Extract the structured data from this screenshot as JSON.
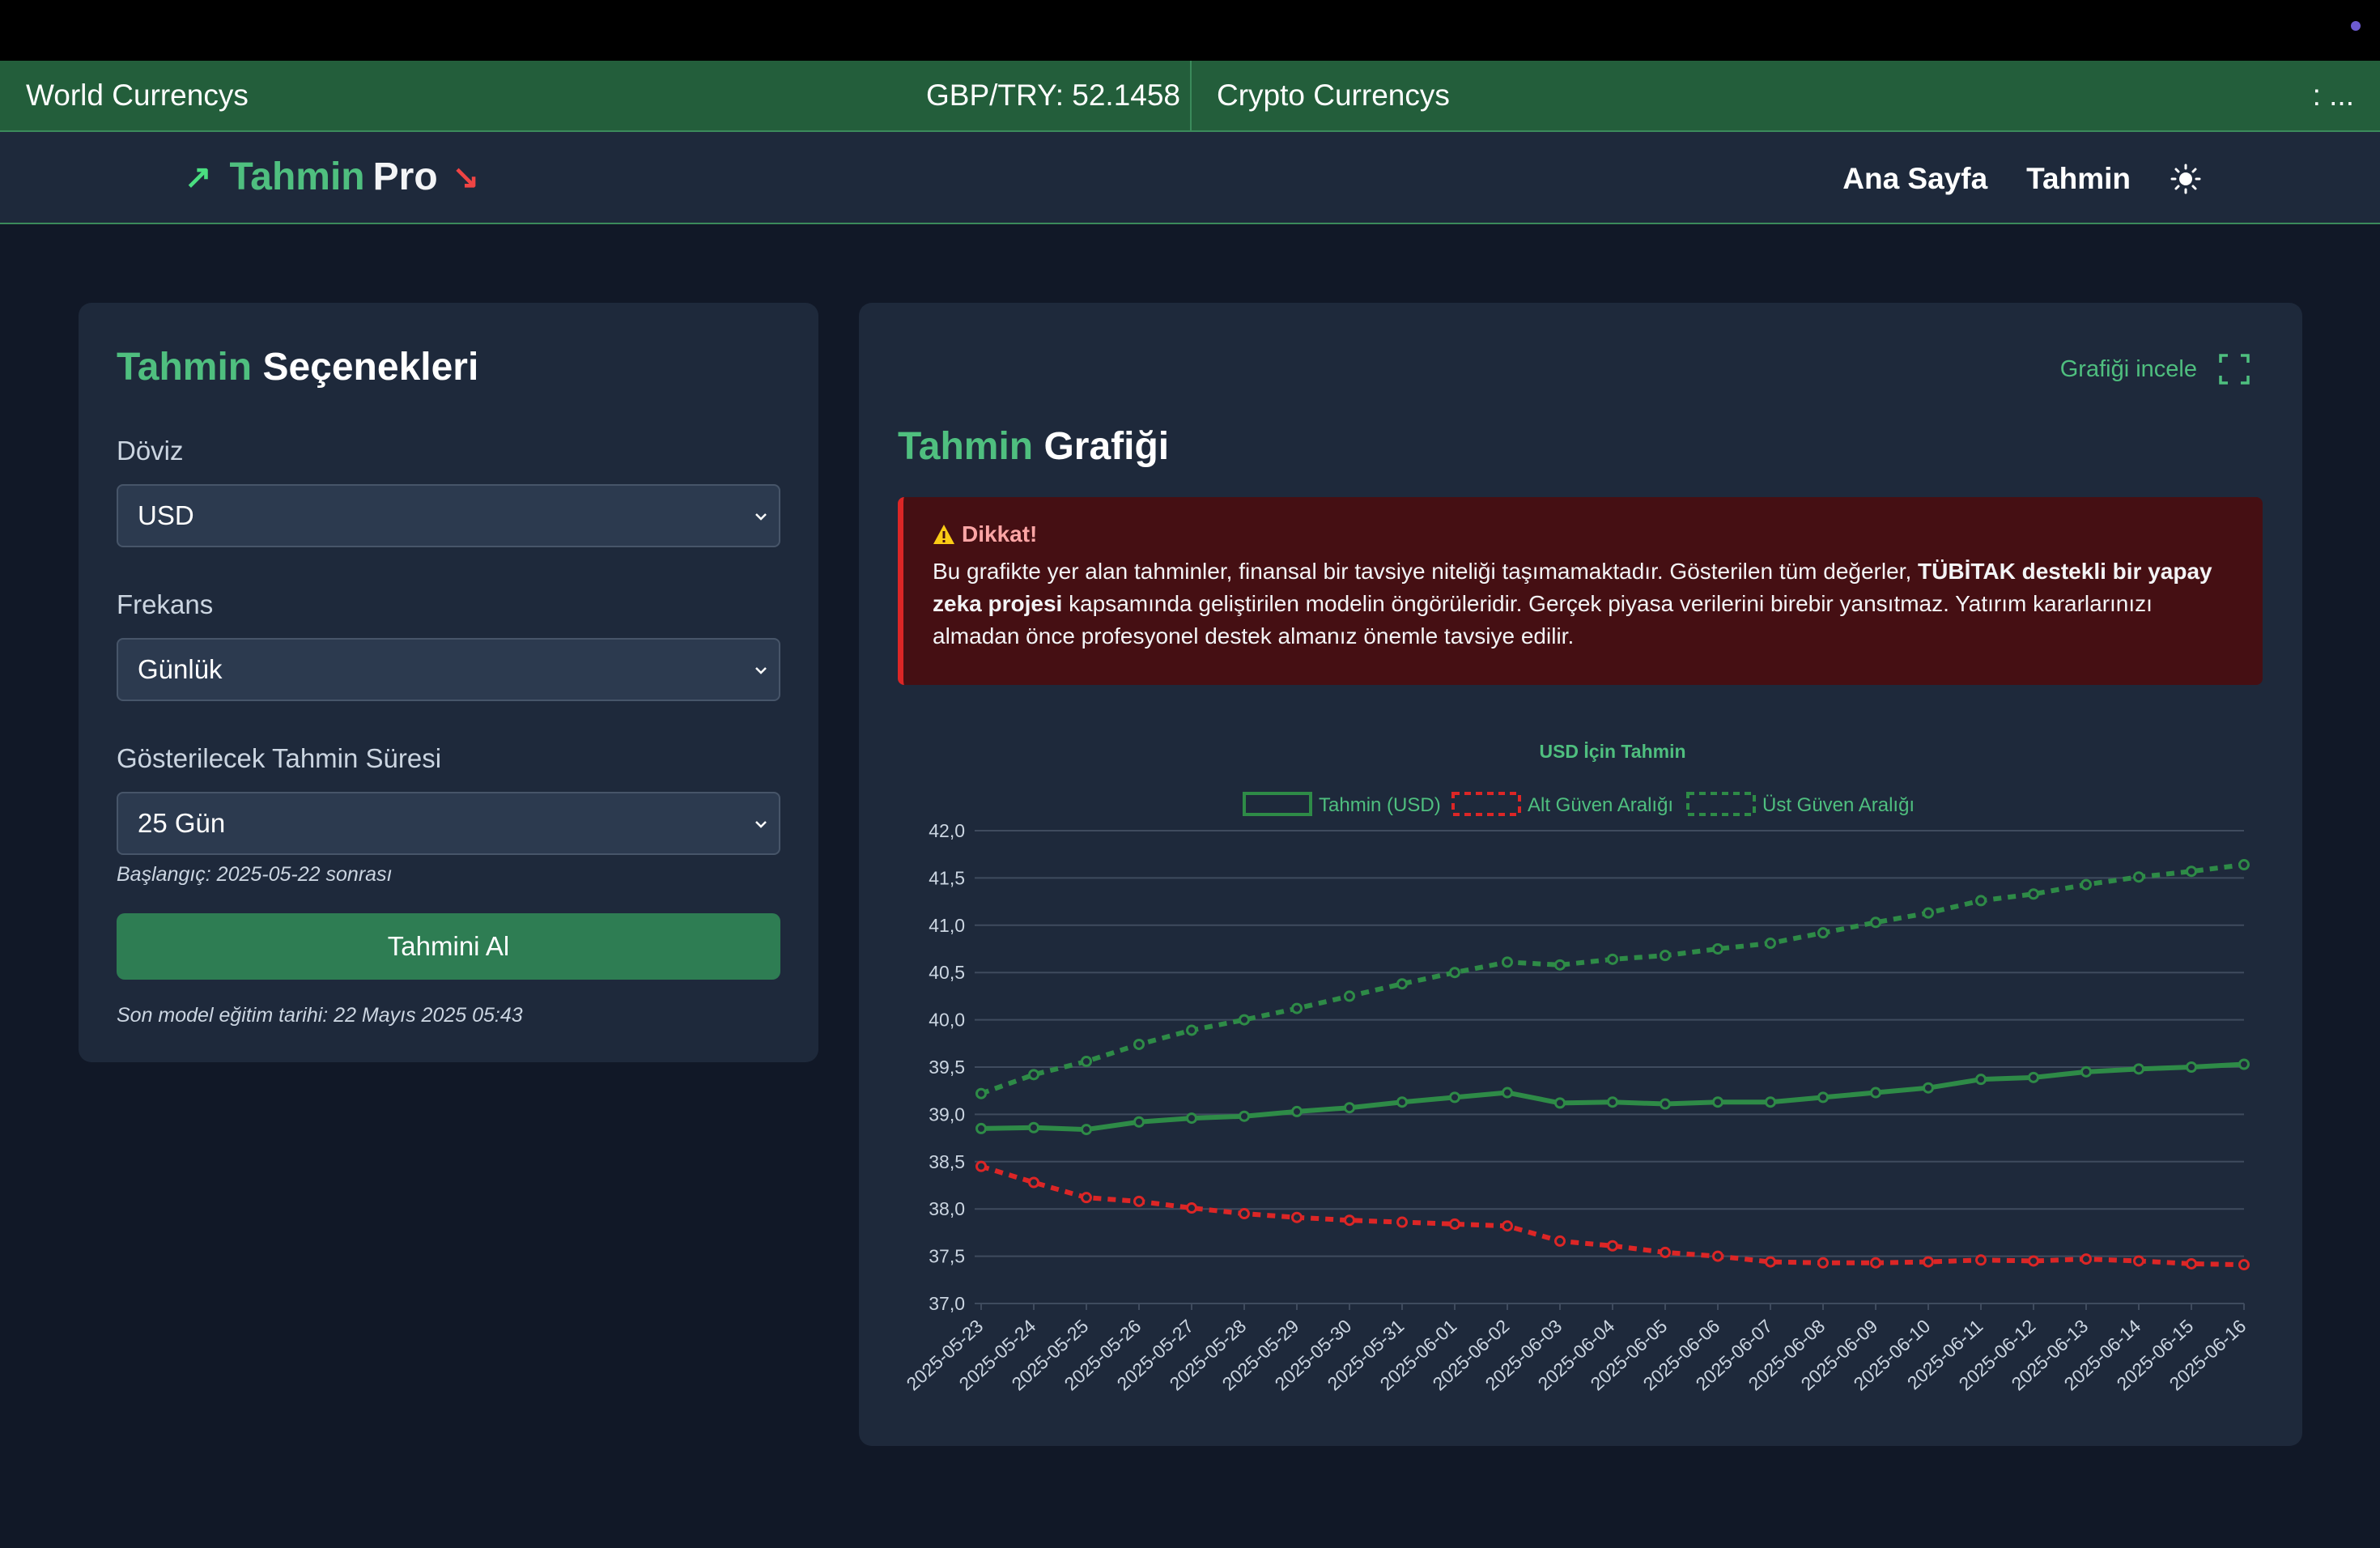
{
  "ticker": {
    "world_label": "World Currencys",
    "rate_text": "GBP/TRY: 52.1458",
    "crypto_label": "Crypto Currencys",
    "more_text": ": ..."
  },
  "navbar": {
    "brand_accent": "Tahmin",
    "brand_rest": "Pro",
    "links": [
      "Ana Sayfa",
      "Tahmin"
    ],
    "theme_icon": "sun-icon"
  },
  "options": {
    "title_accent": "Tahmin",
    "title_rest": "Seçenekleri",
    "currency_label": "Döviz",
    "currency_value": "USD",
    "frequency_label": "Frekans",
    "frequency_value": "Günlük",
    "duration_label": "Gösterilecek Tahmin Süresi",
    "duration_value": "25 Gün",
    "start_note": "Başlangıç: 2025-05-22 sonrası",
    "submit_label": "Tahmini Al",
    "train_note": "Son model eğitim tarihi: 22 Mayıs 2025 05:43"
  },
  "graph_panel": {
    "inspect_label": "Grafiği incele",
    "title_accent": "Tahmin",
    "title_rest": "Grafiği",
    "alert": {
      "title": "Dikkat!",
      "body_1": "Bu grafikte yer alan tahminler, finansal bir tavsiye niteliği taşımamaktadır. Gösterilen tüm değerler,",
      "body_bold": "TÜBİTAK destekli bir yapay zeka projesi",
      "body_2": "kapsamında geliştirilen modelin öngörüleridir. Gerçek piyasa verilerini birebir yansıtmaz. Yatırım kararlarınızı almadan önce profesyonel destek almanız önemle tavsiye edilir."
    }
  },
  "colors": {
    "accent": "#4fbf7f",
    "forecast": "#2e8b47",
    "lower": "#dc2626",
    "upper": "#2e8b47"
  },
  "chart_data": {
    "type": "line",
    "title": "USD İçin Tahmin",
    "legend_position": "top",
    "grid": true,
    "ylim": [
      37.0,
      42.0
    ],
    "yticks": [
      "42,0",
      "41,5",
      "41,0",
      "40,5",
      "40,0",
      "39,5",
      "39,0",
      "38,5",
      "38,0",
      "37,5",
      "37,0"
    ],
    "x": [
      "2025-05-23",
      "2025-05-24",
      "2025-05-25",
      "2025-05-26",
      "2025-05-27",
      "2025-05-28",
      "2025-05-29",
      "2025-05-30",
      "2025-05-31",
      "2025-06-01",
      "2025-06-02",
      "2025-06-03",
      "2025-06-04",
      "2025-06-05",
      "2025-06-06",
      "2025-06-07",
      "2025-06-08",
      "2025-06-09",
      "2025-06-10",
      "2025-06-11",
      "2025-06-12",
      "2025-06-13",
      "2025-06-14",
      "2025-06-15",
      "2025-06-16"
    ],
    "series": [
      {
        "name": "Tahmin (USD)",
        "style": "solid",
        "values": [
          38.85,
          38.86,
          38.84,
          38.92,
          38.96,
          38.98,
          39.03,
          39.07,
          39.13,
          39.18,
          39.23,
          39.12,
          39.13,
          39.11,
          39.13,
          39.13,
          39.18,
          39.23,
          39.28,
          39.37,
          39.39,
          39.45,
          39.48,
          39.5,
          39.53
        ]
      },
      {
        "name": "Alt Güven Aralığı",
        "style": "dashed",
        "values": [
          38.45,
          38.28,
          38.12,
          38.08,
          38.01,
          37.95,
          37.91,
          37.88,
          37.86,
          37.84,
          37.82,
          37.66,
          37.61,
          37.54,
          37.5,
          37.44,
          37.43,
          37.43,
          37.44,
          37.46,
          37.45,
          37.47,
          37.45,
          37.42,
          37.41
        ]
      },
      {
        "name": "Üst Güven Aralığı",
        "style": "dashed",
        "values": [
          39.22,
          39.42,
          39.56,
          39.74,
          39.89,
          40.0,
          40.12,
          40.25,
          40.38,
          40.5,
          40.61,
          40.58,
          40.64,
          40.68,
          40.75,
          40.81,
          40.92,
          41.03,
          41.13,
          41.26,
          41.33,
          41.43,
          41.51,
          41.57,
          41.64
        ]
      }
    ]
  }
}
